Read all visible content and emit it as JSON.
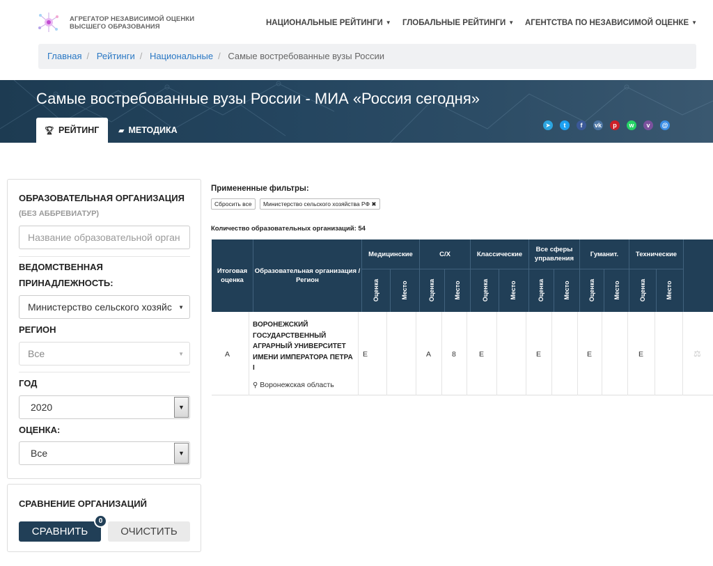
{
  "header": {
    "logo_line1": "АГРЕГАТОР НЕЗАВИСИМОЙ ОЦЕНКИ",
    "logo_line2": "ВЫСШЕГО ОБРАЗОВАНИЯ",
    "nav": [
      "НАЦИОНАЛЬНЫЕ РЕЙТИНГИ",
      "ГЛОБАЛЬНЫЕ РЕЙТИНГИ",
      "АГЕНТСТВА ПО НЕЗАВИСИМОЙ ОЦЕНКЕ"
    ]
  },
  "breadcrumb": [
    "Главная",
    "Рейтинги",
    "Национальные",
    "Самые востребованные вузы России"
  ],
  "banner": {
    "title": "Самые востребованные вузы России - МИА «Россия сегодня»",
    "tab_rating": "РЕЙТИНГ",
    "tab_method": "МЕТОДИКА",
    "share_icons": [
      "telegram-icon",
      "twitter-icon",
      "facebook-icon",
      "vk-icon",
      "pinterest-icon",
      "whatsapp-icon",
      "viber-icon",
      "email-icon"
    ]
  },
  "sidebar": {
    "org_label": "ОБРАЗОВАТЕЛЬНАЯ ОРГАНИЗАЦИЯ",
    "org_sub": "(БЕЗ АББРЕВИАТУР)",
    "org_placeholder": "Название образовательной орган",
    "dept_label_1": "ВЕДОМСТВЕННАЯ",
    "dept_label_2": "ПРИНАДЛЕЖНОСТЬ:",
    "dept_value": "Министерство сельского хозяйс",
    "region_label": "РЕГИОН",
    "region_value": "Все",
    "year_label": "ГОД",
    "year_value": "2020",
    "grade_label": "ОЦЕНКА:",
    "grade_value": "Все"
  },
  "compare": {
    "title": "СРАВНЕНИЕ ОРГАНИЗАЦИЙ",
    "compare_btn": "СРАВНИТЬ",
    "count": "0",
    "clear_btn": "ОЧИСТИТЬ"
  },
  "filters": {
    "title": "Примененные фильтры:",
    "reset": "Сбросить все",
    "applied": "Министерство сельского хозяйства РФ",
    "count_text": "Количество образовательных организаций: 54"
  },
  "table": {
    "col_total": "Итоговая оценка",
    "col_org": "Образовательная организация / Регион",
    "groups": [
      "Медицинские",
      "С/Х",
      "Классические",
      "Все сферы управления",
      "Гуманит.",
      "Технические"
    ],
    "sub_grade": "Оценка",
    "sub_place": "Место",
    "rows": [
      {
        "total": "A",
        "name": "ВОРОНЕЖСКИЙ ГОСУДАРСТВЕННЫЙ АГРАРНЫЙ УНИВЕРСИТЕТ ИМЕНИ ИМПЕРАТОРА ПЕТРА I",
        "region": "Воронежская область",
        "med_grade": "E",
        "med_place": "",
        "agr_grade": "A",
        "agr_place": "8",
        "cls_grade": "E",
        "cls_place": "",
        "mgmt_grade": "E",
        "mgmt_place": "",
        "hum_grade": "E",
        "hum_place": "",
        "tech_grade": "E",
        "tech_place": ""
      }
    ]
  }
}
